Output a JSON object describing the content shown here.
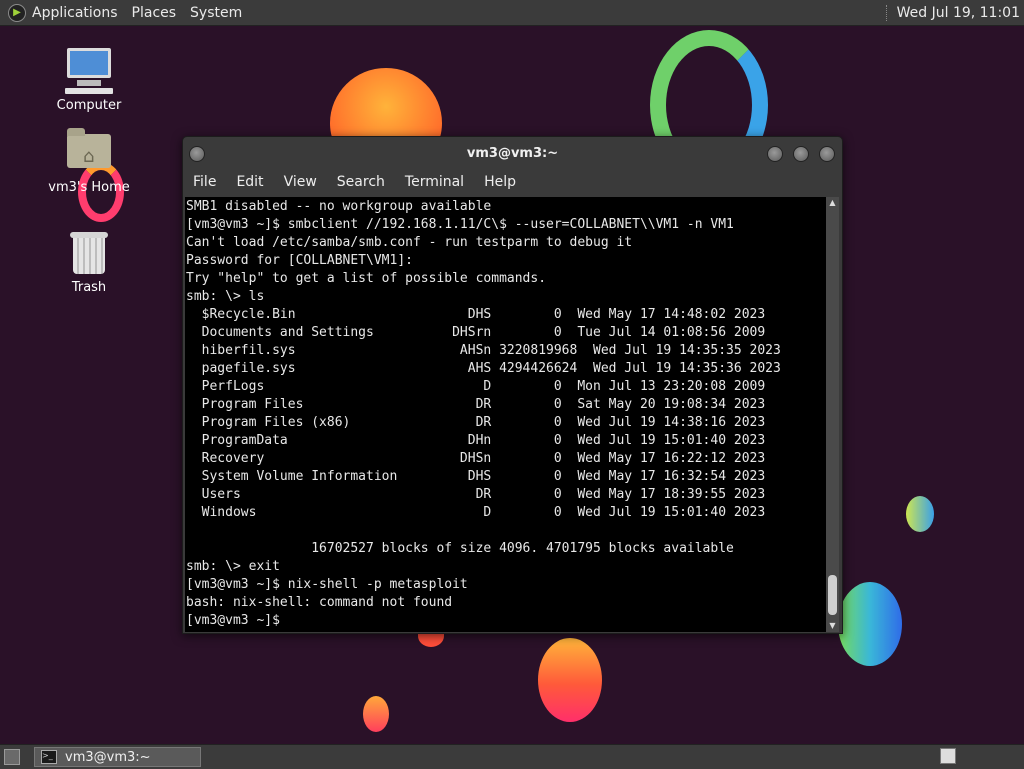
{
  "top_panel": {
    "menus": [
      "Applications",
      "Places",
      "System"
    ],
    "clock": "Wed Jul 19, 11:01"
  },
  "desktop_icons": [
    {
      "label": "Computer",
      "icon": "computer-icon"
    },
    {
      "label": "vm3's Home",
      "icon": "home-folder-icon"
    },
    {
      "label": "Trash",
      "icon": "trash-icon"
    }
  ],
  "terminal_window": {
    "title": "vm3@vm3:~",
    "menu": [
      "File",
      "Edit",
      "View",
      "Search",
      "Terminal",
      "Help"
    ],
    "lines": [
      "SMB1 disabled -- no workgroup available",
      "[vm3@vm3 ~]$ smbclient //192.168.1.11/C\\$ --user=COLLABNET\\\\VM1 -n VM1",
      "Can't load /etc/samba/smb.conf - run testparm to debug it",
      "Password for [COLLABNET\\VM1]:",
      "Try \"help\" to get a list of possible commands.",
      "smb: \\> ls",
      "  $Recycle.Bin                      DHS        0  Wed May 17 14:48:02 2023",
      "  Documents and Settings          DHSrn        0  Tue Jul 14 01:08:56 2009",
      "  hiberfil.sys                     AHSn 3220819968  Wed Jul 19 14:35:35 2023",
      "  pagefile.sys                      AHS 4294426624  Wed Jul 19 14:35:36 2023",
      "  PerfLogs                            D        0  Mon Jul 13 23:20:08 2009",
      "  Program Files                      DR        0  Sat May 20 19:08:34 2023",
      "  Program Files (x86)                DR        0  Wed Jul 19 14:38:16 2023",
      "  ProgramData                       DHn        0  Wed Jul 19 15:01:40 2023",
      "  Recovery                         DHSn        0  Wed May 17 16:22:12 2023",
      "  System Volume Information         DHS        0  Wed May 17 16:32:54 2023",
      "  Users                              DR        0  Wed May 17 18:39:55 2023",
      "  Windows                             D        0  Wed Jul 19 15:01:40 2023",
      "",
      "                16702527 blocks of size 4096. 4701795 blocks available",
      "smb: \\> exit",
      "[vm3@vm3 ~]$ nix-shell -p metasploit",
      "bash: nix-shell: command not found",
      "[vm3@vm3 ~]$"
    ]
  },
  "bottom_panel": {
    "task_label": "vm3@vm3:~"
  }
}
